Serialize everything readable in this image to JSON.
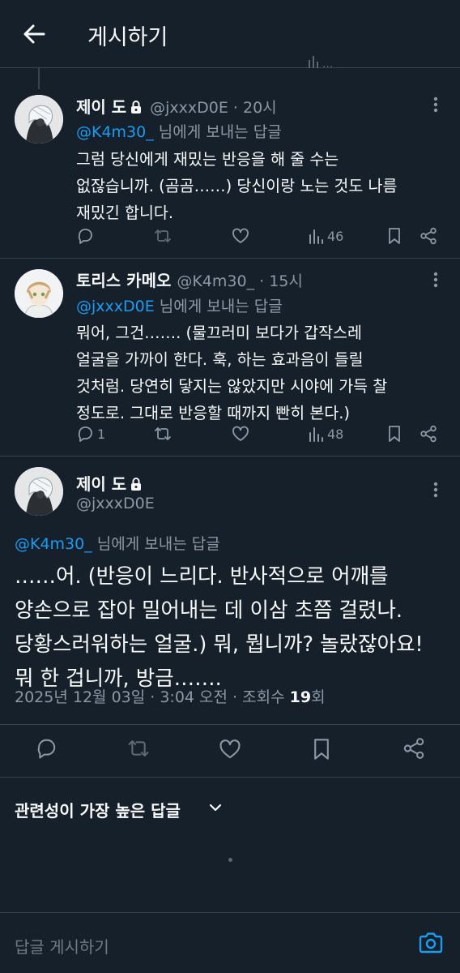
{
  "header": {
    "title": "게시하기"
  },
  "tweets": [
    {
      "name": "제이 도",
      "meta": "@jxxxD0E · 20시",
      "reply_handle": "@K4m30_",
      "reply_suffix": "님에게 보내는 답글",
      "lines": [
        "그럼 당신에게 재밌는 반응을 해 줄 수는",
        "없잖습니까. (곰곰……) 당신이랑 노는 것도 나름",
        "재밌긴 합니다."
      ],
      "replies": "",
      "views": "46"
    },
    {
      "name": "토리스 카메오",
      "meta": "@K4m30_ · 15시",
      "reply_handle": "@jxxxD0E",
      "reply_suffix": "님에게 보내는 답글",
      "lines": [
        "뭐어, 그건……. (물끄러미 보다가 갑작스레",
        "얼굴을 가까이 한다. 훅, 하는 효과음이 들릴",
        "것처럼. 당연히 닿지는 않았지만 시야에 가득 찰",
        "정도로. 그대로 반응할 때까지 빤히 본다.)"
      ],
      "replies": "1",
      "views": "48"
    }
  ],
  "main": {
    "name": "제이 도",
    "handle": "@jxxxD0E",
    "reply_handle": "@K4m30_",
    "reply_suffix": "님에게 보내는 답글",
    "lines": [
      "……어. (반응이 느리다. 반사적으로 어깨를",
      "양손으로 잡아 밀어내는 데 이삼 초쯤 걸렸나.",
      "당황스러워하는 얼굴.) 뭐, 뭡니까? 놀랐잖아요!",
      "뭐 한 겁니까, 방금……."
    ],
    "date": "2025년 12월 03일 · 3:04 오전 · 조회수 ",
    "views": "19",
    "views_suffix": "회"
  },
  "sort": {
    "label": "관련성이 가장 높은 답글"
  },
  "reply_bar": {
    "placeholder": "답글 게시하기"
  },
  "colors": {
    "background": "#15202b",
    "accent": "#1d9bf0",
    "muted": "#8b98a5",
    "border": "#38444d"
  }
}
